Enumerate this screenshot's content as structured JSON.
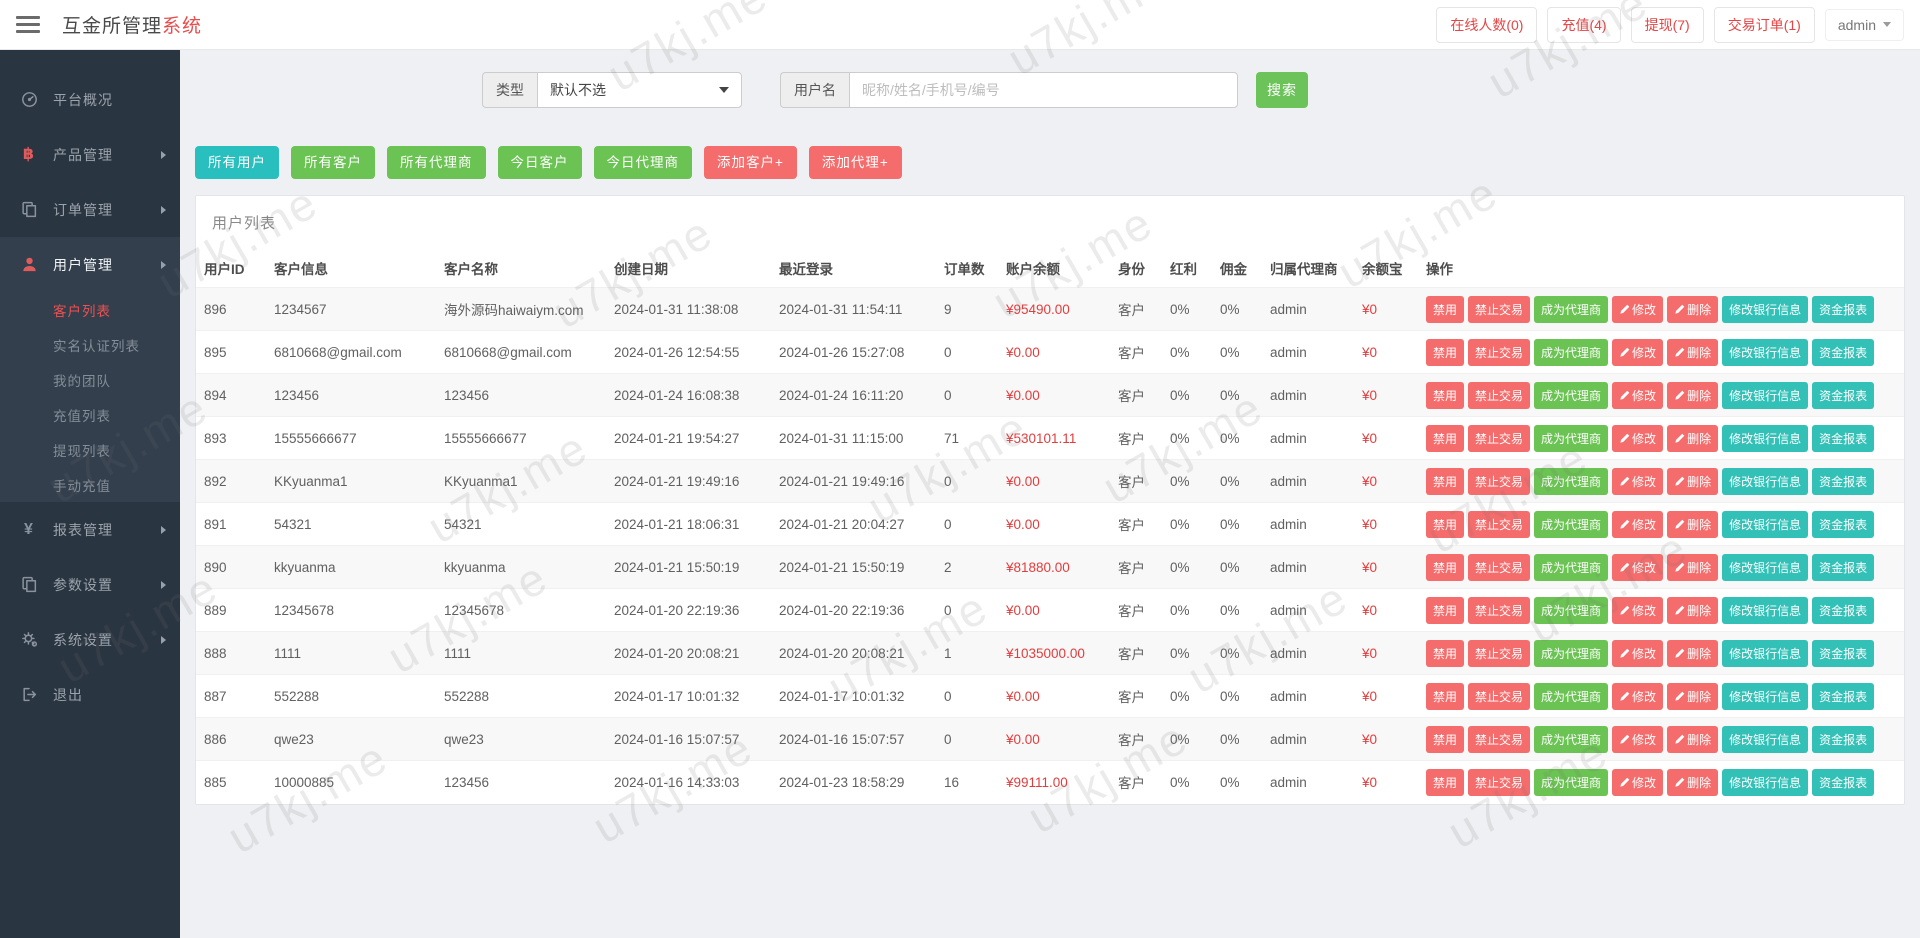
{
  "navbar": {
    "title_main": "互金所管理",
    "title_accent": "系统",
    "badges": [
      {
        "label": "在线人数(0)"
      },
      {
        "label": "充值(4)"
      },
      {
        "label": "提现(7)"
      },
      {
        "label": "交易订单(1)"
      }
    ],
    "user_menu": "admin"
  },
  "sidebar": {
    "items": [
      {
        "label": "平台概况",
        "icon": "gauge-icon",
        "arrow": false
      },
      {
        "label": "产品管理",
        "icon": "bitcoin-icon",
        "arrow": true
      },
      {
        "label": "订单管理",
        "icon": "orders-icon",
        "arrow": true
      },
      {
        "label": "用户管理",
        "icon": "user-icon",
        "arrow": true,
        "expanded": true,
        "children": [
          "客户列表",
          "实名认证列表",
          "我的团队",
          "充值列表",
          "提现列表",
          "手动充值"
        ],
        "active_child": "客户列表"
      },
      {
        "label": "报表管理",
        "icon": "yen-icon",
        "arrow": true
      },
      {
        "label": "参数设置",
        "icon": "params-icon",
        "arrow": true
      },
      {
        "label": "系统设置",
        "icon": "gear-icon",
        "arrow": true
      },
      {
        "label": "退出",
        "icon": "logout-icon",
        "arrow": false
      }
    ]
  },
  "filters": {
    "type_label": "类型",
    "type_value": "默认不选",
    "username_label": "用户名",
    "username_placeholder": "昵称/姓名/手机号/编号",
    "search_button": "搜索"
  },
  "toolbar": {
    "buttons": [
      {
        "label": "所有用户",
        "color": "teal"
      },
      {
        "label": "所有客户",
        "color": "green"
      },
      {
        "label": "所有代理商",
        "color": "green"
      },
      {
        "label": "今日客户",
        "color": "green"
      },
      {
        "label": "今日代理商",
        "color": "green"
      },
      {
        "label": "添加客户+",
        "color": "red"
      },
      {
        "label": "添加代理+",
        "color": "red"
      }
    ]
  },
  "panel": {
    "title": "用户列表",
    "columns": [
      "用户ID",
      "客户信息",
      "客户名称",
      "创建日期",
      "最近登录",
      "订单数",
      "账户余额",
      "身份",
      "红利",
      "佣金",
      "归属代理商",
      "余额宝",
      "操作"
    ],
    "row_actions": [
      {
        "label": "禁用",
        "color": "red",
        "icon": ""
      },
      {
        "label": "禁止交易",
        "color": "red",
        "icon": ""
      },
      {
        "label": "成为代理商",
        "color": "green",
        "icon": ""
      },
      {
        "label": "修改",
        "color": "red",
        "icon": "pencil-icon"
      },
      {
        "label": "删除",
        "color": "red",
        "icon": "pencil-icon"
      },
      {
        "label": "修改银行信息",
        "color": "teal",
        "icon": ""
      },
      {
        "label": "资金报表",
        "color": "teal",
        "icon": ""
      }
    ],
    "rows": [
      {
        "id": "896",
        "info": "1234567",
        "name": "海外源码haiwaiym.com",
        "created": "2024-01-31 11:38:08",
        "last_login": "2024-01-31 11:54:11",
        "orders": "9",
        "balance": "¥95490.00",
        "role": "客户",
        "bonus": "0%",
        "commission": "0%",
        "agent": "admin",
        "yuebao": "¥0"
      },
      {
        "id": "895",
        "info": "6810668@gmail.com",
        "name": "6810668@gmail.com",
        "created": "2024-01-26 12:54:55",
        "last_login": "2024-01-26 15:27:08",
        "orders": "0",
        "balance": "¥0.00",
        "role": "客户",
        "bonus": "0%",
        "commission": "0%",
        "agent": "admin",
        "yuebao": "¥0"
      },
      {
        "id": "894",
        "info": "123456",
        "name": "123456",
        "created": "2024-01-24 16:08:38",
        "last_login": "2024-01-24 16:11:20",
        "orders": "0",
        "balance": "¥0.00",
        "role": "客户",
        "bonus": "0%",
        "commission": "0%",
        "agent": "admin",
        "yuebao": "¥0"
      },
      {
        "id": "893",
        "info": "15555666677",
        "name": "15555666677",
        "created": "2024-01-21 19:54:27",
        "last_login": "2024-01-31 11:15:00",
        "orders": "71",
        "balance": "¥530101.11",
        "role": "客户",
        "bonus": "0%",
        "commission": "0%",
        "agent": "admin",
        "yuebao": "¥0"
      },
      {
        "id": "892",
        "info": "KKyuanma1",
        "name": "KKyuanma1",
        "created": "2024-01-21 19:49:16",
        "last_login": "2024-01-21 19:49:16",
        "orders": "0",
        "balance": "¥0.00",
        "role": "客户",
        "bonus": "0%",
        "commission": "0%",
        "agent": "admin",
        "yuebao": "¥0"
      },
      {
        "id": "891",
        "info": "54321",
        "name": "54321",
        "created": "2024-01-21 18:06:31",
        "last_login": "2024-01-21 20:04:27",
        "orders": "0",
        "balance": "¥0.00",
        "role": "客户",
        "bonus": "0%",
        "commission": "0%",
        "agent": "admin",
        "yuebao": "¥0"
      },
      {
        "id": "890",
        "info": "kkyuanma",
        "name": "kkyuanma",
        "created": "2024-01-21 15:50:19",
        "last_login": "2024-01-21 15:50:19",
        "orders": "2",
        "balance": "¥81880.00",
        "role": "客户",
        "bonus": "0%",
        "commission": "0%",
        "agent": "admin",
        "yuebao": "¥0"
      },
      {
        "id": "889",
        "info": "12345678",
        "name": "12345678",
        "created": "2024-01-20 22:19:36",
        "last_login": "2024-01-20 22:19:36",
        "orders": "0",
        "balance": "¥0.00",
        "role": "客户",
        "bonus": "0%",
        "commission": "0%",
        "agent": "admin",
        "yuebao": "¥0"
      },
      {
        "id": "888",
        "info": "1111",
        "name": "1111",
        "created": "2024-01-20 20:08:21",
        "last_login": "2024-01-20 20:08:21",
        "orders": "1",
        "balance": "¥1035000.00",
        "role": "客户",
        "bonus": "0%",
        "commission": "0%",
        "agent": "admin",
        "yuebao": "¥0"
      },
      {
        "id": "887",
        "info": "552288",
        "name": "552288",
        "created": "2024-01-17 10:01:32",
        "last_login": "2024-01-17 10:01:32",
        "orders": "0",
        "balance": "¥0.00",
        "role": "客户",
        "bonus": "0%",
        "commission": "0%",
        "agent": "admin",
        "yuebao": "¥0"
      },
      {
        "id": "886",
        "info": "qwe23",
        "name": "qwe23",
        "created": "2024-01-16 15:07:57",
        "last_login": "2024-01-16 15:07:57",
        "orders": "0",
        "balance": "¥0.00",
        "role": "客户",
        "bonus": "0%",
        "commission": "0%",
        "agent": "admin",
        "yuebao": "¥0"
      },
      {
        "id": "885",
        "info": "10000885",
        "name": "123456",
        "created": "2024-01-16 14:33:03",
        "last_login": "2024-01-23 18:58:29",
        "orders": "16",
        "balance": "¥99111.00",
        "role": "客户",
        "bonus": "0%",
        "commission": "0%",
        "agent": "admin",
        "yuebao": "¥0"
      }
    ]
  },
  "watermark": "u7kj.me",
  "colors": {
    "accent_red": "#e84c4c",
    "badge_red": "#e64545",
    "sidebar_bg": "#2a3542",
    "button_teal": "#2abfbf",
    "button_green": "#6ac352",
    "button_red": "#f56c6c",
    "action_teal": "#33c1b7",
    "balance_red": "#e23d3d",
    "search_green": "#6cc35a"
  }
}
